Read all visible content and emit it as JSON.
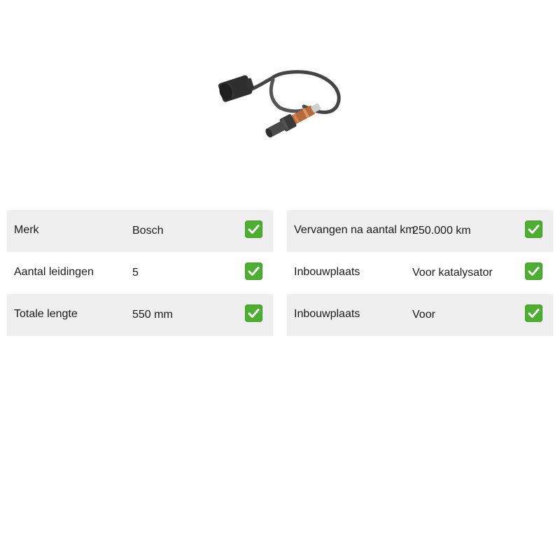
{
  "product": {
    "image_icon": "oxygen-sensor-image"
  },
  "specs_left": [
    {
      "label": "Merk",
      "value": "Bosch",
      "check_icon": "check-icon"
    },
    {
      "label": "Aantal leidingen",
      "value": "5",
      "check_icon": "check-icon"
    },
    {
      "label": "Totale lengte",
      "value": "550 mm",
      "check_icon": "check-icon"
    }
  ],
  "specs_right": [
    {
      "label": "Vervangen na aantal km",
      "value": "250.000 km",
      "check_icon": "check-icon"
    },
    {
      "label": "Inbouwplaats",
      "value": "Voor katalysator",
      "check_icon": "check-icon"
    },
    {
      "label": "Inbouwplaats",
      "value": "Voor",
      "check_icon": "check-icon"
    }
  ],
  "colors": {
    "row_shade": "#efefef",
    "check_green": "#4caf2f"
  }
}
